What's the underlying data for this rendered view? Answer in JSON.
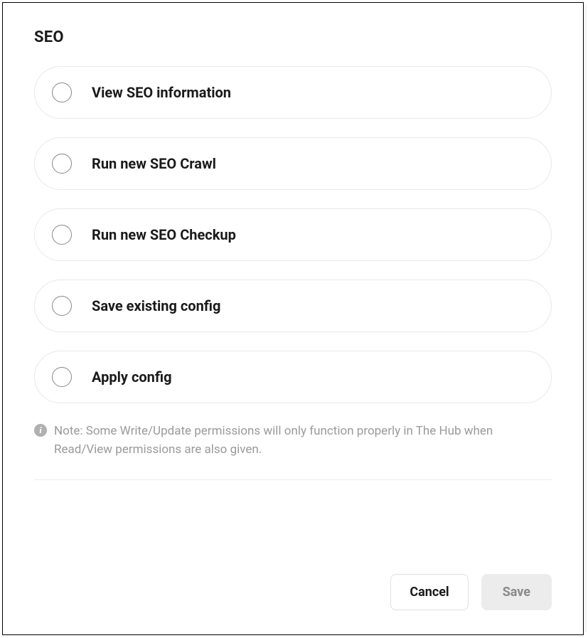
{
  "section": {
    "title": "SEO"
  },
  "options": [
    {
      "label": "View SEO information"
    },
    {
      "label": "Run new SEO Crawl"
    },
    {
      "label": "Run new SEO Checkup"
    },
    {
      "label": "Save existing config"
    },
    {
      "label": "Apply config"
    }
  ],
  "note": {
    "text": "Note: Some Write/Update permissions will only function properly in The Hub when Read/View permissions are also given."
  },
  "footer": {
    "cancel": "Cancel",
    "save": "Save"
  }
}
